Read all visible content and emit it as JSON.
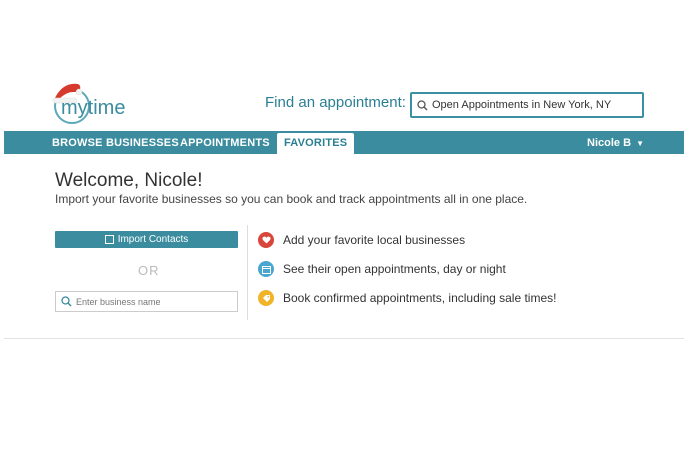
{
  "brand": {
    "logo_text": "mytime",
    "color": "#3a8c9e"
  },
  "header": {
    "find_label": "Find an appointment:",
    "search_value": "Open Appointments in New York, NY"
  },
  "nav": {
    "items": [
      {
        "label": "BROWSE BUSINESSES"
      },
      {
        "label": "APPOINTMENTS"
      },
      {
        "label": "FAVORITES",
        "active": true
      }
    ],
    "user_label": "Nicole B"
  },
  "main": {
    "welcome": "Welcome, Nicole!",
    "subtitle": "Import your favorite businesses so you can book and track appointments all in one place.",
    "import_button": "Import Contacts",
    "or_text": "OR",
    "business_placeholder": "Enter business name",
    "features": [
      {
        "text": "Add your favorite local businesses",
        "icon": "heart-icon",
        "color": "#d9463b"
      },
      {
        "text": "See their open appointments, day or night",
        "icon": "calendar-icon",
        "color": "#4aa6cf"
      },
      {
        "text": "Book confirmed appointments, including sale times!",
        "icon": "tag-icon",
        "color": "#f0b429"
      }
    ]
  }
}
